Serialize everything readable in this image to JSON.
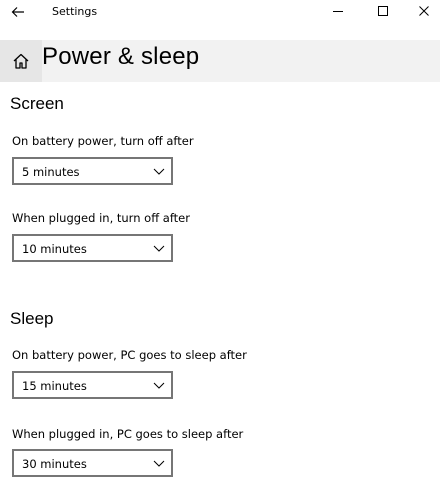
{
  "titlebar": {
    "app_title": "Settings",
    "back_icon": "back-arrow-icon",
    "minimize_icon": "minimize-icon",
    "maximize_icon": "maximize-icon",
    "close_icon": "close-icon"
  },
  "header": {
    "home_icon": "home-icon",
    "title": "Power & sleep"
  },
  "screen": {
    "title": "Screen",
    "battery": {
      "label": "On battery power, turn off after",
      "value": "5 minutes"
    },
    "plugged": {
      "label": "When plugged in, turn off after",
      "value": "10 minutes"
    }
  },
  "sleep": {
    "title": "Sleep",
    "battery": {
      "label": "On battery power, PC goes to sleep after",
      "value": "15 minutes"
    },
    "plugged": {
      "label": "When plugged in, PC goes to sleep after",
      "value": "30 minutes"
    }
  },
  "colors": {
    "header_bg": "#f2f2f2",
    "home_bg": "#e6e6e6",
    "dropdown_border": "#767676"
  }
}
